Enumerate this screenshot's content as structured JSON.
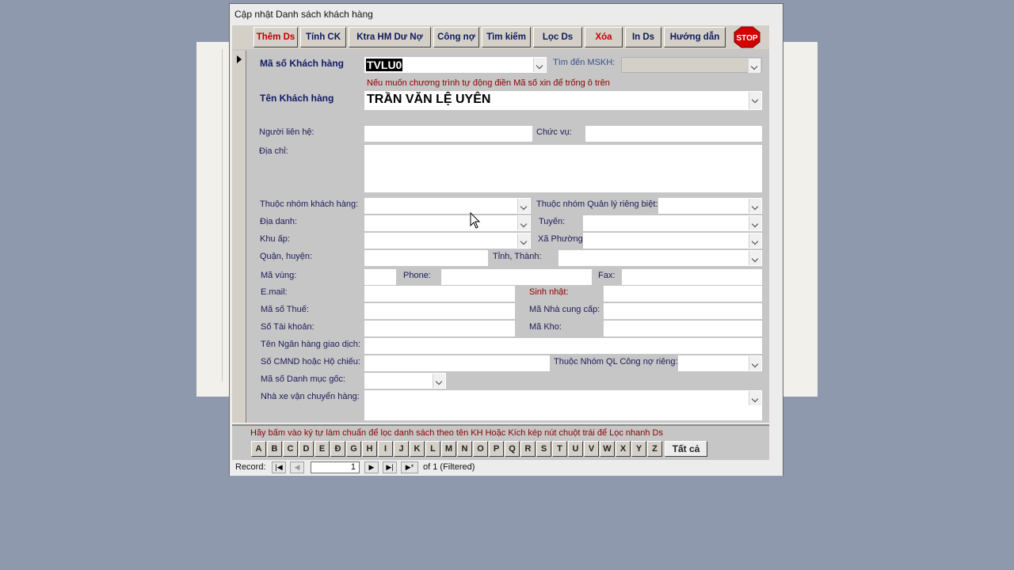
{
  "window": {
    "title": "Cập nhật Danh sách khách hàng"
  },
  "toolbar": {
    "buttons": [
      {
        "label": "Thêm Ds"
      },
      {
        "label": "Tính CK"
      },
      {
        "label": "Ktra HM Dư Nợ"
      },
      {
        "label": "Công nợ"
      },
      {
        "label": "Tìm kiếm"
      },
      {
        "label": "Lọc Ds"
      },
      {
        "label": "Xóa"
      },
      {
        "label": "In Ds"
      },
      {
        "label": "Hướng dẫn"
      }
    ],
    "stop_label": "STOP"
  },
  "form": {
    "ma_so_kh": {
      "label": "Mã số Khách hàng",
      "value": "TVLU0"
    },
    "tim_den": {
      "label": "Tìm đến MSKH:",
      "value": ""
    },
    "hint": "Nếu muốn chương trình tự động điền Mã số xin để trống ô trên",
    "ten_kh": {
      "label": "Tên Khách hàng",
      "value": "TRẦN VĂN LỆ UYÊN"
    },
    "nguoi_lien_he": {
      "label": "Người liên hệ:",
      "value": ""
    },
    "chuc_vu": {
      "label": "Chức vụ:",
      "value": ""
    },
    "dia_chi": {
      "label": "Địa chỉ:",
      "value": ""
    },
    "nhom_kh": {
      "label": "Thuộc nhóm khách hàng:",
      "value": ""
    },
    "nhom_ql": {
      "label": "Thuộc nhóm Quản lý riêng biệt:",
      "value": ""
    },
    "dia_danh": {
      "label": "Địa danh:",
      "value": ""
    },
    "tuyen": {
      "label": "Tuyến:",
      "value": ""
    },
    "khu_ap": {
      "label": "Khu ấp:",
      "value": ""
    },
    "xa_phuong": {
      "label": "Xã Phường:",
      "value": ""
    },
    "quan_huyen": {
      "label": "Quận, huyện:",
      "value": ""
    },
    "tinh_thanh": {
      "label": "Tỉnh, Thành:",
      "value": ""
    },
    "ma_vung": {
      "label": "Mã vùng:",
      "value": ""
    },
    "phone": {
      "label": "Phone:",
      "value": ""
    },
    "fax": {
      "label": "Fax:",
      "value": ""
    },
    "email": {
      "label": "E.mail:",
      "value": ""
    },
    "sinh_nhat": {
      "label": "Sinh nhật:",
      "value": ""
    },
    "ma_so_thue": {
      "label": "Mã số Thuế:",
      "value": ""
    },
    "ma_ncc": {
      "label": "Mã Nhà cung cấp:",
      "value": ""
    },
    "so_tk": {
      "label": "Số Tài khoản:",
      "value": ""
    },
    "ma_kho": {
      "label": "Mã Kho:",
      "value": ""
    },
    "ngan_hang": {
      "label": "Tên Ngân hàng giao dịch:",
      "value": ""
    },
    "cmnd": {
      "label": "Số CMND hoặc Hộ chiếu:",
      "value": ""
    },
    "nhom_cong_no": {
      "label": "Thuộc Nhóm QL Công nợ riêng:",
      "value": ""
    },
    "ma_dm_goc": {
      "label": "Mã số Danh mục gốc:",
      "value": ""
    },
    "nha_xe": {
      "label": "Nhà xe vận chuyển hàng:",
      "value": ""
    }
  },
  "footer": {
    "hint": "Hãy bấm vào ký tự làm chuẩn để lọc danh sách theo tên KH Hoặc Kích kép nút chuột trái để Lọc nhanh Ds",
    "letters": [
      "A",
      "B",
      "C",
      "D",
      "E",
      "Đ",
      "G",
      "H",
      "I",
      "J",
      "K",
      "L",
      "M",
      "N",
      "O",
      "P",
      "Q",
      "R",
      "S",
      "T",
      "U",
      "V",
      "W",
      "X",
      "Y",
      "Z"
    ],
    "all_label": "Tất cả"
  },
  "navigation": {
    "record_label": "Record:",
    "current": "1",
    "of_text": "of  1 (Filtered)"
  }
}
